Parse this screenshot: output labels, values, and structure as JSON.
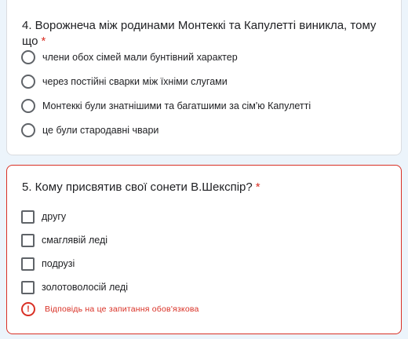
{
  "question4": {
    "title": "4. Ворожнеча між родинами Монтеккі та Капулетті виникла, тому що",
    "required_mark": "*",
    "options": [
      {
        "label": "члени обох сімей мали бунтівний характер",
        "selected": false
      },
      {
        "label": "через постійні сварки між їхніми слугами",
        "selected": false
      },
      {
        "label": "Монтеккі були знатнішими та багатшими за сім'ю Капулетті",
        "selected": false
      },
      {
        "label": "це були стародавні чвари",
        "selected": false
      }
    ]
  },
  "question5": {
    "title": "5. Кому присвятив свої сонети В.Шекспір?",
    "required_mark": "*",
    "options": [
      {
        "label": "другу",
        "checked": false
      },
      {
        "label": "смаглявій леді",
        "checked": false
      },
      {
        "label": "подрузі",
        "checked": false
      },
      {
        "label": "золотоволосій леді",
        "checked": false
      }
    ],
    "error": {
      "icon": "error-circle-icon",
      "symbol": "!",
      "text": "Відповідь на це запитання обов'язкова"
    }
  },
  "colors": {
    "accent_error": "#d93025",
    "background": "#ecf4fb"
  }
}
